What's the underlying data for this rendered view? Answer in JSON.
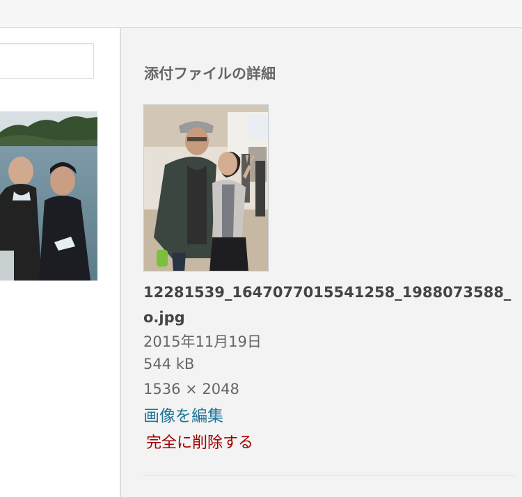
{
  "attachment_details": {
    "title": "添付ファイルの詳細",
    "filename": "12281539_1647077015541258_1988073588_o.jpg",
    "date": "2015年11月19日",
    "file_size": "544 kB",
    "dimensions": "1536 × 2048",
    "edit_image_label": "画像を編集",
    "delete_permanently_label": "完全に削除する"
  },
  "colors": {
    "link": "#21759b",
    "delete": "#a00000",
    "sidebar_bg": "#f3f3f3"
  }
}
